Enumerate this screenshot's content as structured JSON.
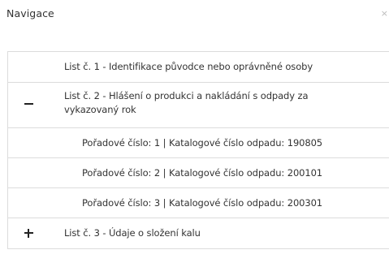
{
  "header": {
    "title": "Navigace",
    "close_glyph": "×"
  },
  "nav": {
    "items": [
      {
        "label": "List č. 1 - Identifikace původce nebo oprávněné osoby"
      },
      {
        "label": "List č. 2 - Hlášení o produkci a nakládání s odpady za vykazovaný rok",
        "state": "expanded"
      },
      {
        "label": "List č. 3 - Údaje o složení kalu",
        "state": "collapsed"
      }
    ],
    "subitems": [
      {
        "label": "Pořadové číslo: 1 | Katalogové číslo odpadu: 190805"
      },
      {
        "label": "Pořadové číslo: 2 | Katalogové číslo odpadu: 200101"
      },
      {
        "label": "Pořadové číslo: 3 | Katalogové číslo odpadu: 200301"
      }
    ]
  },
  "icons": {
    "close": "close-icon",
    "expanded": "minus-icon",
    "collapsed": "plus-icon"
  }
}
